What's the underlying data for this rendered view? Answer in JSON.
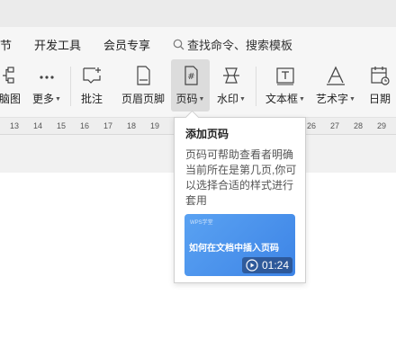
{
  "menubar": {
    "items": [
      {
        "label": "节"
      },
      {
        "label": "开发工具"
      },
      {
        "label": "会员专享"
      }
    ],
    "search_label": "查找命令、搜索模板"
  },
  "ribbon": {
    "tools": [
      {
        "label": "脑图",
        "icon": "mindmap-icon"
      },
      {
        "label": "更多",
        "icon": "more-icon"
      },
      {
        "label": "批注",
        "icon": "comment-icon"
      },
      {
        "label": "页眉页脚",
        "icon": "header-footer-icon"
      },
      {
        "label": "页码",
        "icon": "page-number-icon"
      },
      {
        "label": "水印",
        "icon": "watermark-icon"
      },
      {
        "label": "文本框",
        "icon": "textbox-icon"
      },
      {
        "label": "艺术字",
        "icon": "wordart-icon"
      },
      {
        "label": "日期",
        "icon": "date-icon"
      }
    ]
  },
  "ruler": {
    "ticks": [
      "13",
      "14",
      "15",
      "16",
      "17",
      "18",
      "19",
      "26",
      "27",
      "28",
      "29"
    ]
  },
  "tooltip": {
    "title": "添加页码",
    "description": "页码可帮助查看者明确当前所在是第几页,你可以选择合适的样式进行套用",
    "video": {
      "brand": "WPS学堂",
      "title": "如何在文档中插入页码",
      "duration": "01:24"
    }
  },
  "colors": {
    "accent": "#3d84e6",
    "ribbon_bg": "#f6f6f6",
    "active_bg": "#dcdcdc"
  }
}
